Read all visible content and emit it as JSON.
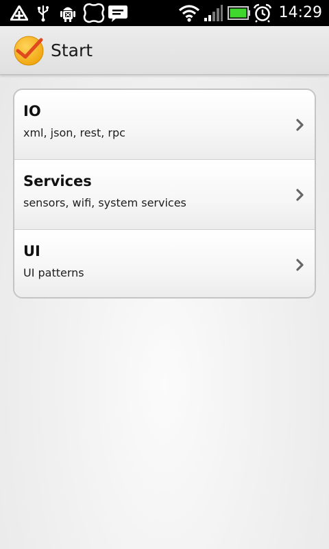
{
  "status_bar": {
    "time": "14:29",
    "icons": [
      "drive-sync-icon",
      "usb-icon",
      "android-debug-icon",
      "app-notification-icon",
      "message-icon",
      "wifi-icon",
      "signal-icon",
      "battery-icon",
      "alarm-icon"
    ]
  },
  "action_bar": {
    "title": "Start",
    "logo_icon": "checkmark-logo-icon"
  },
  "list": {
    "items": [
      {
        "title": "IO",
        "subtitle": "xml, json, rest, rpc"
      },
      {
        "title": "Services",
        "subtitle": "sensors, wifi, system services"
      },
      {
        "title": "UI",
        "subtitle": "UI patterns"
      }
    ]
  },
  "colors": {
    "logo_fill": "#f7b818",
    "logo_check": "#e0481e",
    "battery": "#3fd62e",
    "chevron": "#666666"
  }
}
